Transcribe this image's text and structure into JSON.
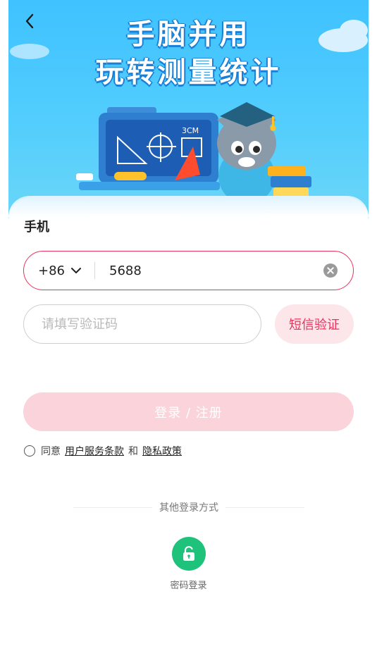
{
  "banner": {
    "title_line1": "手脑并用",
    "title_line2": "玩转测量统计",
    "board_text": "3CM"
  },
  "form": {
    "section_label": "手机",
    "country_code": "+86",
    "phone_value": "5688",
    "code_placeholder": "请填写验证码",
    "sms_button": "短信验证",
    "login_button": "登录 / 注册"
  },
  "agreement": {
    "prefix": "同意",
    "terms_link": "用户服务条款",
    "and": "和",
    "privacy_link": "隐私政策"
  },
  "other_login": {
    "title": "其他登录方式",
    "password_login": "密码登录"
  },
  "colors": {
    "accent": "#e8335d",
    "sms_bg": "#fde6ea",
    "login_disabled": "#fbd3da",
    "password_green": "#1fc27a",
    "banner_blue": "#3fc2ff"
  },
  "icons": {
    "back": "chevron-left-icon",
    "dropdown": "chevron-down-icon",
    "clear": "clear-circle-icon",
    "password": "unlock-icon"
  }
}
